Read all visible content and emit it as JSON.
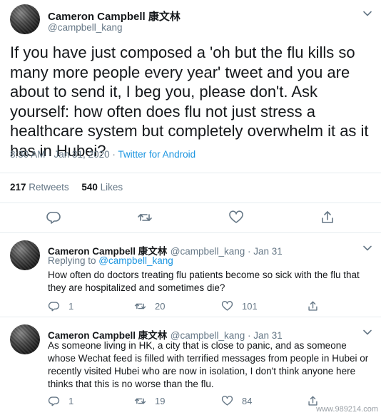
{
  "tweet": {
    "author_name": "Cameron Campbell 康文林",
    "author_handle": "@campbell_kang",
    "text": "If you have just composed a 'oh but the flu kills so many more people every year' tweet and you are about to send it, I beg you, please don't. Ask yourself: how often does flu not just stress a healthcare system but completely overwhelm it as it has in Hubei?",
    "time": "8:30 AM · Jan 31, 2020 · ",
    "source": "Twitter for Android",
    "retweets_count": "217",
    "retweets_label": "Retweets",
    "likes_count": "540",
    "likes_label": "Likes",
    "actions": [
      "reply-icon",
      "retweet-icon",
      "like-icon",
      "share-icon"
    ]
  },
  "replies": [
    {
      "author_name": "Cameron Campbell 康文林",
      "author_handle": "@campbell_kang · Jan 31",
      "replying_prefix": "Replying to ",
      "replying_to": "@campbell_kang",
      "text": "How often do doctors treating flu patients become so sick with the flu that they are hospitalized and sometimes die?",
      "reply_count": "1",
      "retweet_count": "20",
      "like_count": "101"
    },
    {
      "author_name": "Cameron Campbell 康文林",
      "author_handle": "@campbell_kang · Jan 31",
      "text": "As someone living in HK, a city that is close to panic, and as someone whose Wechat feed is filled with terrified messages from people in Hubei or recently visited Hubei who are now in isolation, I don't think anyone here thinks that this is no worse than the flu.",
      "reply_count": "1",
      "retweet_count": "19",
      "like_count": "84"
    }
  ],
  "watermark": "www.989214.com",
  "colors": {
    "text": "#14171a",
    "muted": "#657786",
    "link": "#1b95e0",
    "divider": "#e6ecf0"
  }
}
